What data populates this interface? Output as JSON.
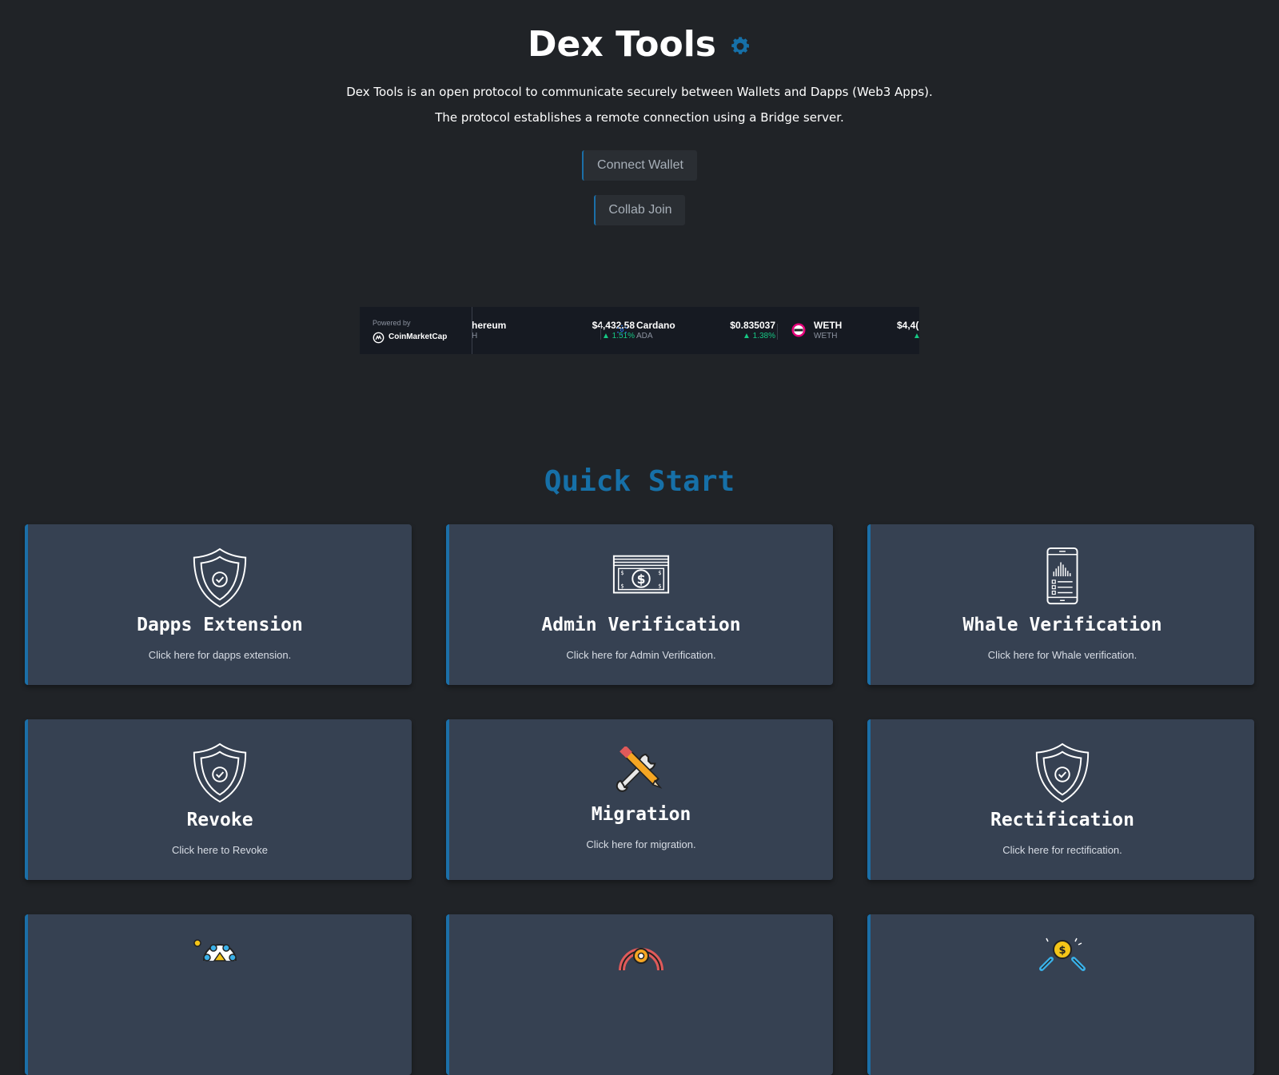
{
  "header": {
    "title": "Dex Tools",
    "description_line1": "Dex Tools is an open protocol to communicate securely between Wallets and Dapps (Web3 Apps).",
    "description_line2": "The protocol establishes a remote connection using a Bridge server.",
    "accent_color": "#1670a8"
  },
  "buttons": {
    "connect_wallet": "Connect Wallet",
    "collab_join": "Collab Join"
  },
  "ticker": {
    "powered_by": "Powered by",
    "brand": "CoinMarketCap",
    "coins": [
      {
        "name": "hereum",
        "symbol": "H",
        "price": "$4,432.58",
        "change": "▲ 1.51%"
      },
      {
        "name": "Cardano",
        "symbol": "ADA",
        "price": "$0.835037",
        "change": "▲ 1.38%"
      },
      {
        "name": "WETH",
        "symbol": "WETH",
        "price": "$4,4(",
        "change": "▲"
      }
    ],
    "positive_color": "#16c784"
  },
  "quick_start": {
    "title": "Quick Start",
    "cards": [
      {
        "title": "Dapps Extension",
        "desc": "Click here for dapps extension.",
        "icon": "shield-check-icon"
      },
      {
        "title": "Admin Verification",
        "desc": "Click here for Admin Verification.",
        "icon": "banknote-icon"
      },
      {
        "title": "Whale Verification",
        "desc": "Click here for Whale verification.",
        "icon": "smartphone-chart-icon"
      },
      {
        "title": "Revoke",
        "desc": "Click here to Revoke",
        "icon": "shield-check-icon"
      },
      {
        "title": "Migration",
        "desc": "Click here for migration.",
        "icon": "pencil-wrench-icon"
      },
      {
        "title": "Rectification",
        "desc": "Click here for rectification.",
        "icon": "shield-check-icon"
      }
    ]
  }
}
